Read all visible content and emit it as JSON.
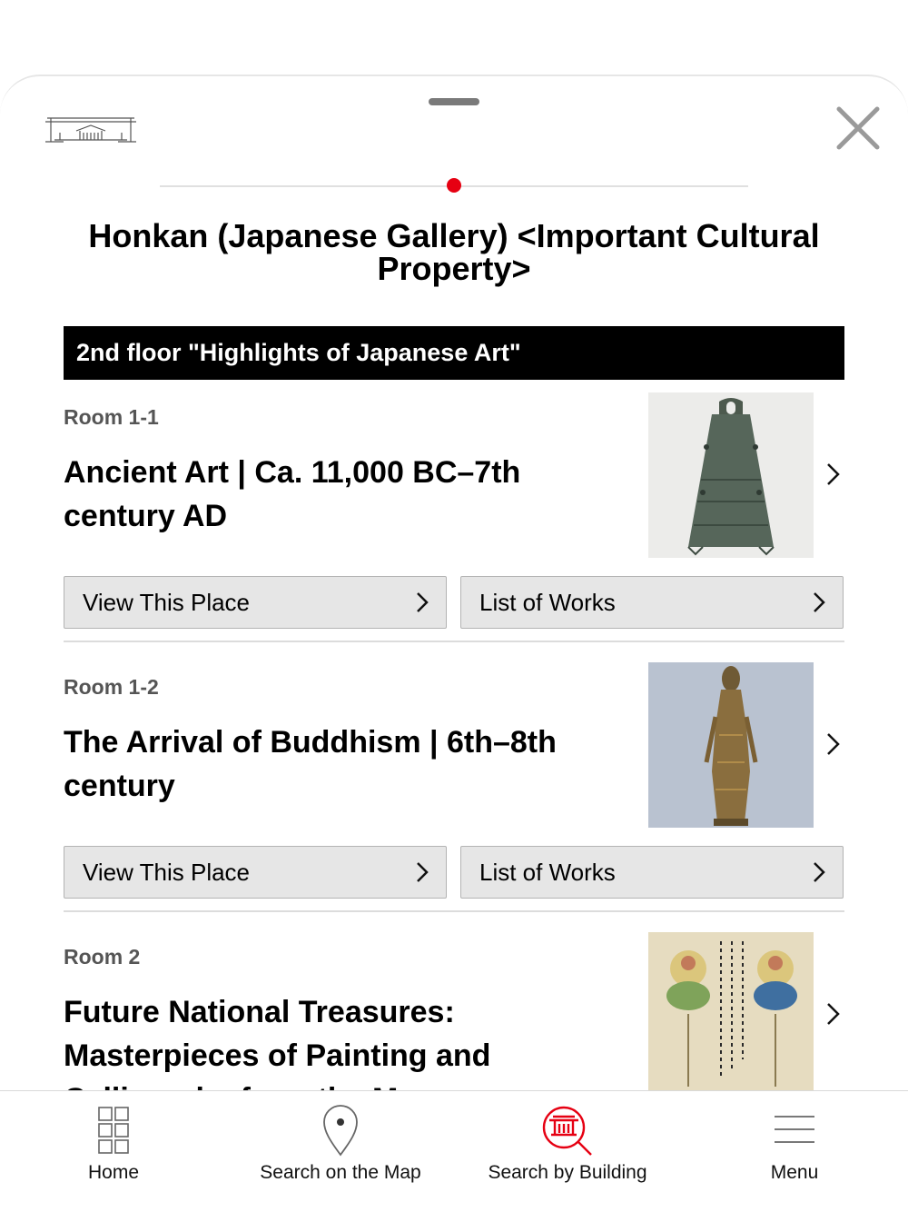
{
  "header": {
    "title": "Honkan (Japanese Gallery) <Important Cultural Property>",
    "building_icon": "building-outline-icon",
    "close_icon": "close-icon"
  },
  "floor": {
    "label": "2nd floor \"Highlights of Japanese Art\""
  },
  "rooms": [
    {
      "room": "Room 1-1",
      "title": "Ancient Art | Ca. 11,000 BC–7th century AD",
      "view_label": "View This Place",
      "works_label": "List of Works"
    },
    {
      "room": "Room 1-2",
      "title": "The Arrival of Buddhism | 6th–8th century",
      "view_label": "View This Place",
      "works_label": "List of Works"
    },
    {
      "room": "Room 2",
      "title": "Future National Treasures: Masterpieces of Painting and Calligraphy from the Muse"
    }
  ],
  "nav": [
    {
      "label": "Home",
      "icon": "grid-icon"
    },
    {
      "label": "Search on the Map",
      "icon": "map-pin-icon"
    },
    {
      "label": "Search by Building",
      "icon": "building-search-icon"
    },
    {
      "label": "Menu",
      "icon": "hamburger-menu-icon"
    }
  ],
  "colors": {
    "accent": "#e60012",
    "floor_bar": "#000000",
    "button_bg": "#e6e6e6"
  }
}
